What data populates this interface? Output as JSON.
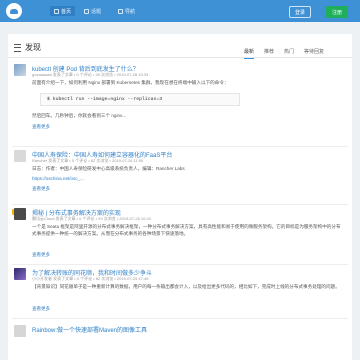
{
  "nav": {
    "items": [
      "首页",
      "话题",
      "导航"
    ],
    "login": "登录",
    "register": "注册"
  },
  "page": {
    "title": "发现",
    "tabs": [
      "最新",
      "推荐",
      "热门",
      "等待回复"
    ]
  },
  "items": [
    {
      "title": "kubectl 创建 Pod 背后到底发生了什么？",
      "meta": "gozaaaaad 发表了文章 • 0 个评论 • 49 次浏览 • 2019-07-28 15:33",
      "body": "前面有介绍一下，如何利用 Nginx 部署到 Kubernetes 集群，我现在想在终端中输入以下的命令：",
      "code": "$ kubectl run --image=nginx --replicas=3",
      "after": "然后回车。几秒钟后，你就会看到三个 nginx...",
      "more": "查看更多"
    },
    {
      "title": "中国人寿保险：中国人寿如何建立容器化的FaaS平台",
      "meta": "Rancher 发表了文章 • 0 个评论 • 82 次浏览 • 2019-07-26 11:50",
      "body": "日志：作者：中国人寿保险研发中心高级系统负责人，编辑：Rancher Labs",
      "link": "https://oschina.net/osc_...",
      "more": "查看更多"
    },
    {
      "title": "揭秘 | 分布式事务解决方案的实现",
      "meta": "腾讯云Cloud 发表了文章 • 0 个评论 • 93 次浏览 • 2019-07-26 10:43",
      "body": "一个是 Seata 框架是阿里开源的分布式事务解决框架，一种分布式事务解决方案，具有高性能和易于使用的微服务架构。它的目标是为服务架构中的分布式事务提供一种统一的解决方案。从而在分布式事务的各种场景下快速落地。",
      "more": "查看更多"
    },
    {
      "title": "为了解决转账的同花顺，我和时间做多少争斗",
      "meta": "小小开发者 发表了文章 • 0 个评论 • 82 次浏览 • 2019-07-25 17:46",
      "body": "【背景知识】同花顺单子是一种重新计算的数据，用户的每一条输出都会计入，以及给出更多代码的，相比如下，完成时上线的分布式事务处理的问题。",
      "more": "查看更多"
    },
    {
      "title": "Rainbow:做一个快速部署Maven的图像工具",
      "meta": "",
      "body": "",
      "more": ""
    }
  ],
  "colors": {
    "topbar": "#3f91d6",
    "accent": "#2f7fc6",
    "register": "#1faf5a"
  }
}
